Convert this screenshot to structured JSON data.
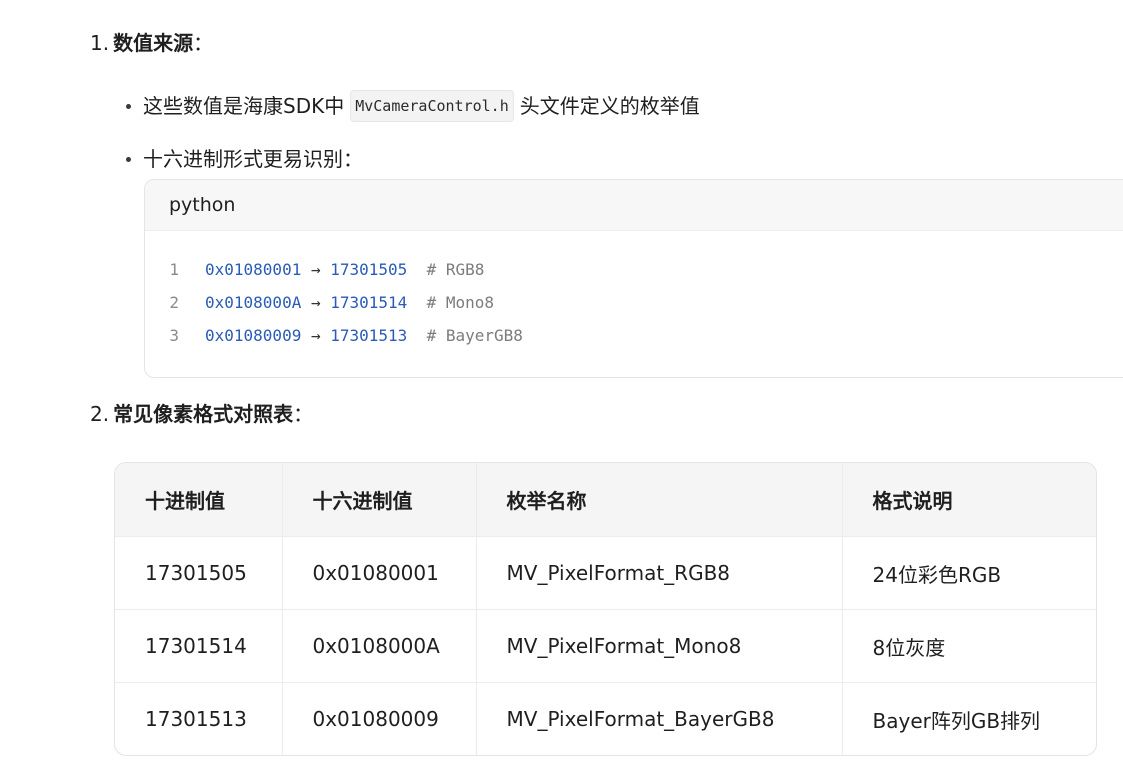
{
  "section1": {
    "num": "1.",
    "title": "数值来源",
    "colon": "："
  },
  "bullets": [
    {
      "before": "这些数值是海康SDK中",
      "code": "MvCameraControl.h",
      "after": "头文件定义的枚举值"
    },
    {
      "text": "十六进制形式更易识别："
    }
  ],
  "code_block": {
    "language": "python",
    "lines": [
      {
        "ln": "1",
        "hex": "0x01080001",
        "arrow": " → ",
        "dec": "17301505",
        "comment": "  # RGB8"
      },
      {
        "ln": "2",
        "hex": "0x0108000A",
        "arrow": " → ",
        "dec": "17301514",
        "comment": "  # Mono8"
      },
      {
        "ln": "3",
        "hex": "0x01080009",
        "arrow": " → ",
        "dec": "17301513",
        "comment": "  # BayerGB8"
      }
    ]
  },
  "section2": {
    "num": "2.",
    "title": "常见像素格式对照表",
    "colon": "："
  },
  "table": {
    "headers": [
      "十进制值",
      "十六进制值",
      "枚举名称",
      "格式说明"
    ],
    "rows": [
      [
        "17301505",
        "0x01080001",
        "MV_PixelFormat_RGB8",
        "24位彩色RGB"
      ],
      [
        "17301514",
        "0x0108000A",
        "MV_PixelFormat_Mono8",
        "8位灰度"
      ],
      [
        "17301513",
        "0x01080009",
        "MV_PixelFormat_BayerGB8",
        "Bayer阵列GB排列"
      ]
    ]
  }
}
